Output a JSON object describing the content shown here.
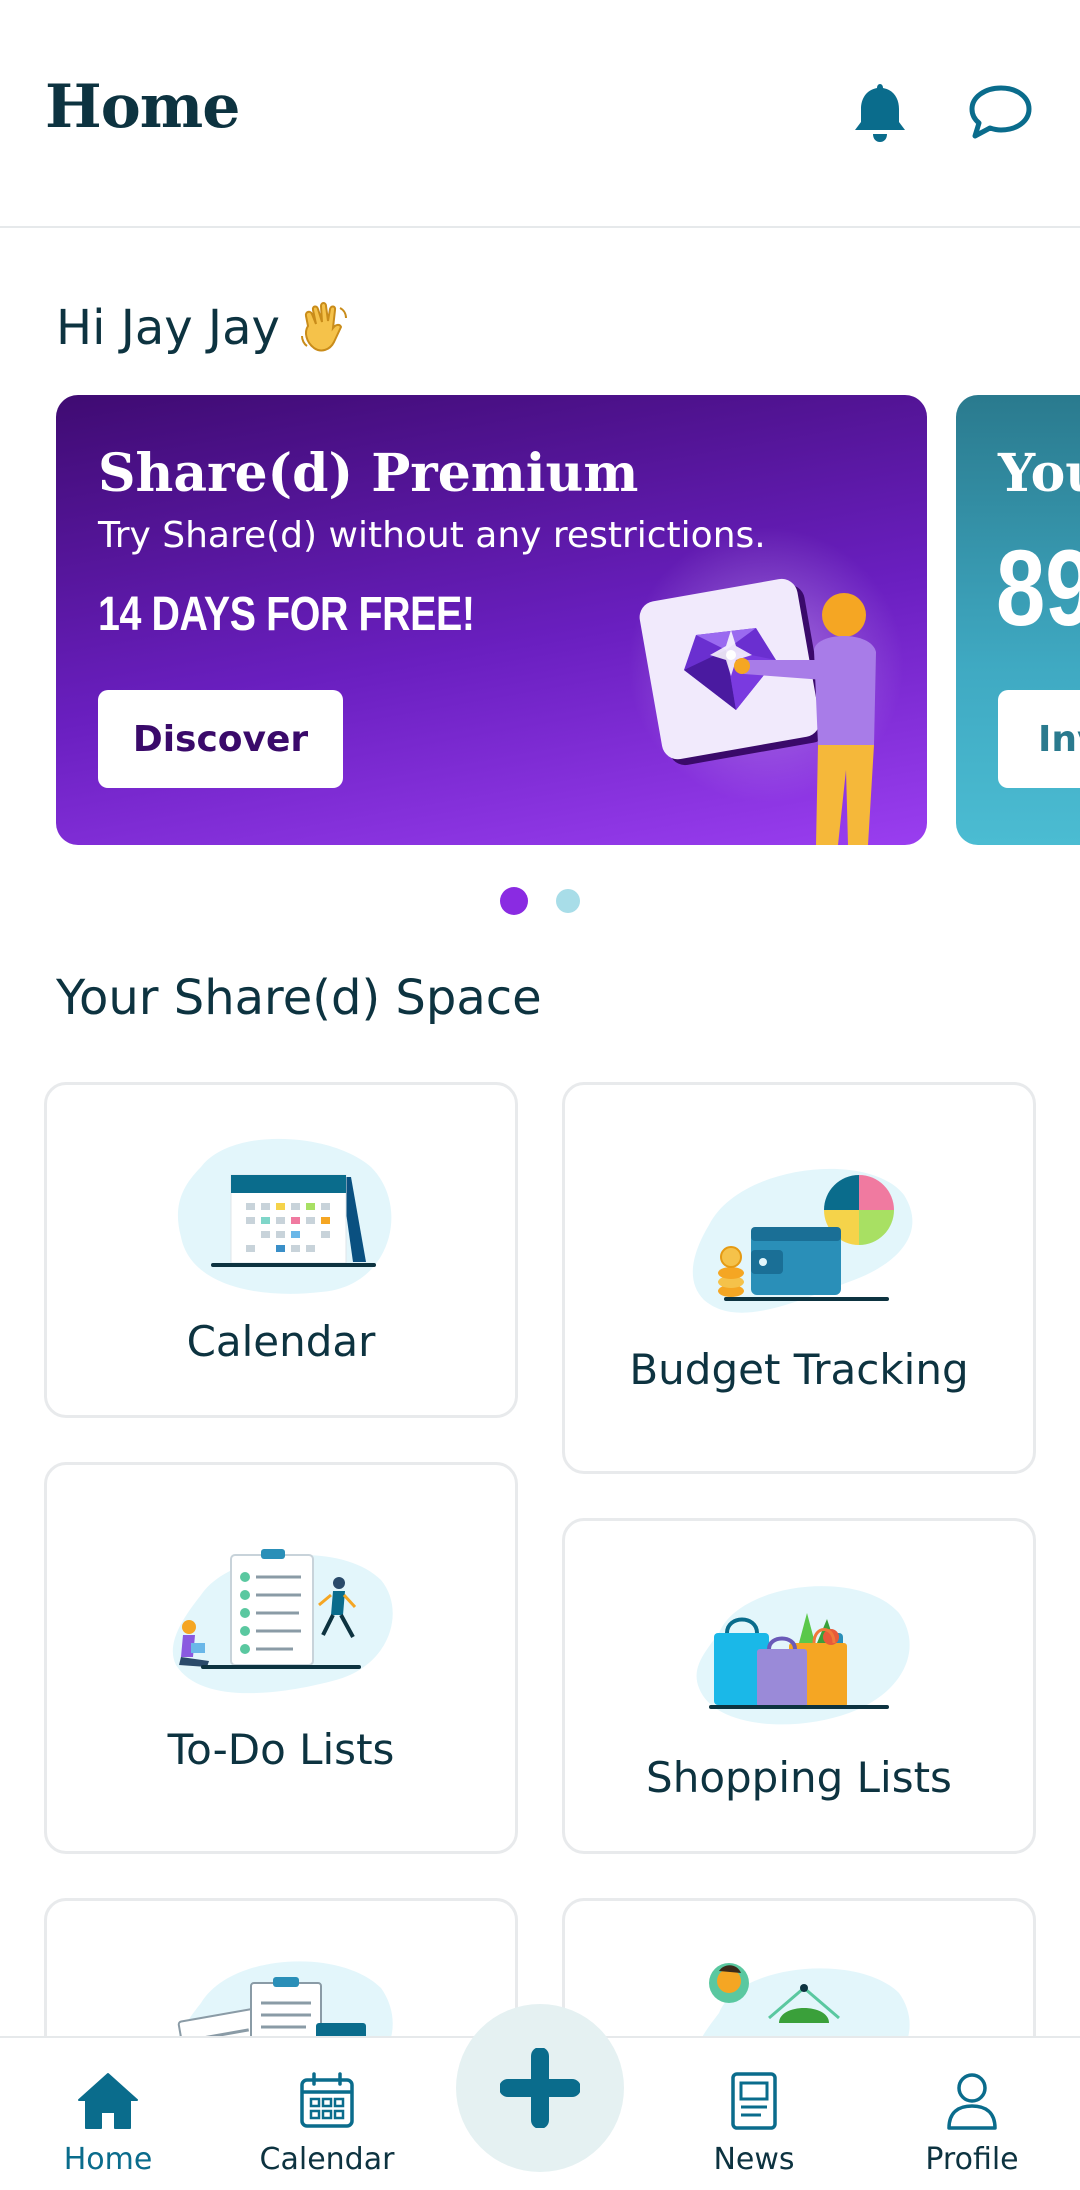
{
  "header": {
    "title": "Home",
    "notifications_icon": "bell-icon",
    "messages_icon": "chat-bubble-icon"
  },
  "greeting": {
    "text": "Hi Jay Jay",
    "emoji_icon": "waving-hand-icon"
  },
  "carousel": {
    "cards": [
      {
        "title": "Share(d) Premium",
        "subtitle": "Try Share(d) without any restrictions.",
        "promo": "14 DAYS FOR FREE!",
        "button_label": "Discover",
        "illustration": "person-with-diamond-illustration"
      },
      {
        "title": "You",
        "number": "89",
        "button_label": "Inv"
      }
    ],
    "active_index": 0,
    "dots_count": 2
  },
  "space": {
    "title": "Your Share(d) Space",
    "tiles": [
      {
        "label": "Calendar",
        "illustration": "calendar-illustration"
      },
      {
        "label": "Budget Tracking",
        "illustration": "wallet-piechart-illustration"
      },
      {
        "label": "To-Do Lists",
        "illustration": "checklist-illustration"
      },
      {
        "label": "Shopping Lists",
        "illustration": "shopping-bags-illustration"
      },
      {
        "label": "",
        "illustration": "documents-illustration"
      },
      {
        "label": "",
        "illustration": "food-illustration"
      }
    ]
  },
  "bottom_nav": {
    "items": [
      {
        "label": "Home",
        "icon": "home-icon",
        "active": true
      },
      {
        "label": "Calendar",
        "icon": "calendar-icon",
        "active": false
      },
      {
        "label": "",
        "icon": "plus-icon",
        "active": false
      },
      {
        "label": "News",
        "icon": "news-icon",
        "active": false
      },
      {
        "label": "Profile",
        "icon": "profile-icon",
        "active": false
      }
    ]
  },
  "colors": {
    "primary": "#0a6c8c",
    "text_dark": "#0d3340",
    "premium_purple": "#6a1fc0",
    "teal_card": "#3fa9c2",
    "dot_active": "#8a2be2",
    "dot_inactive": "#a8dde8",
    "fab_bg": "#e5f1f2"
  }
}
